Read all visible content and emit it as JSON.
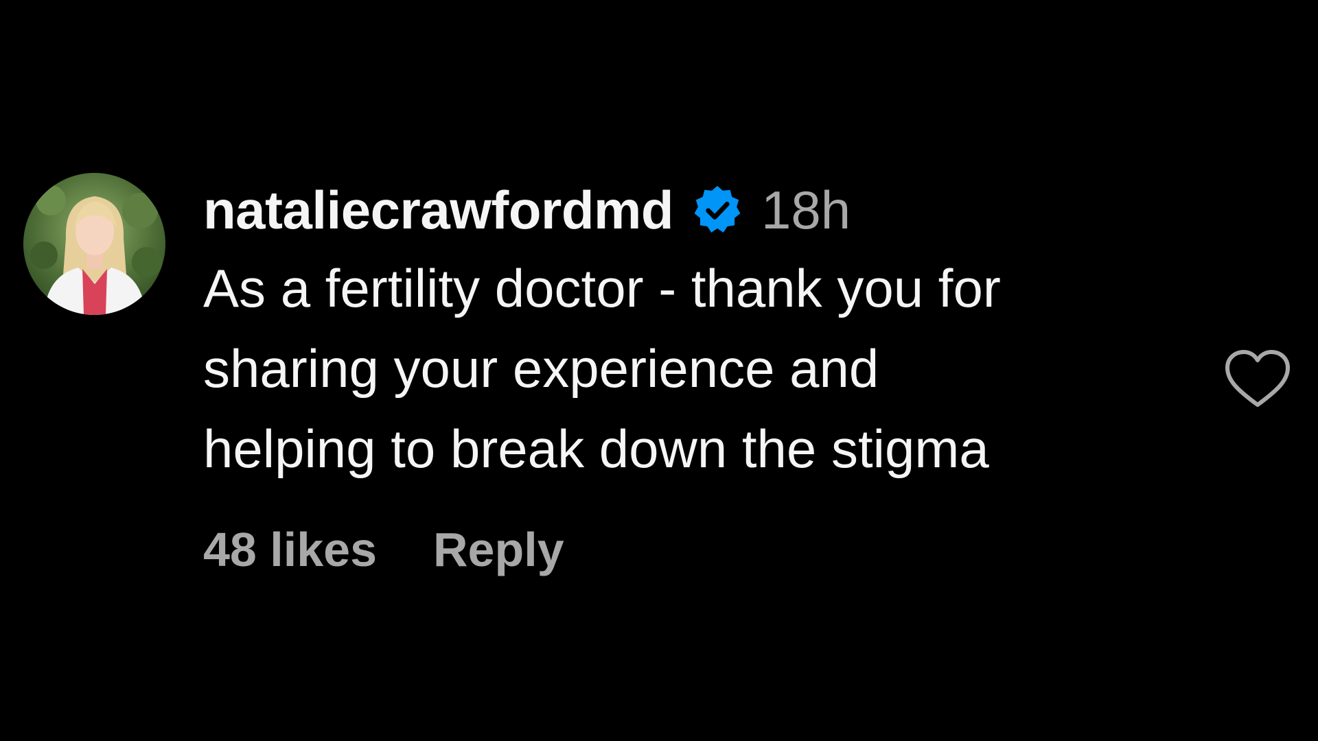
{
  "comment": {
    "username": "nataliecrawfordmd",
    "verified": true,
    "time": "18h",
    "text_lines": [
      "As a fertility doctor - thank you for",
      "sharing your experience and",
      "helping to break down the stigma"
    ],
    "likes": "48 likes",
    "reply_label": "Reply"
  },
  "icons": {
    "verified": "verified-badge-icon",
    "like": "heart-outline-icon"
  },
  "colors": {
    "background": "#000000",
    "primary_text": "#f5f5f5",
    "secondary_text": "#a8a8a8",
    "verified_blue": "#0095f6"
  }
}
